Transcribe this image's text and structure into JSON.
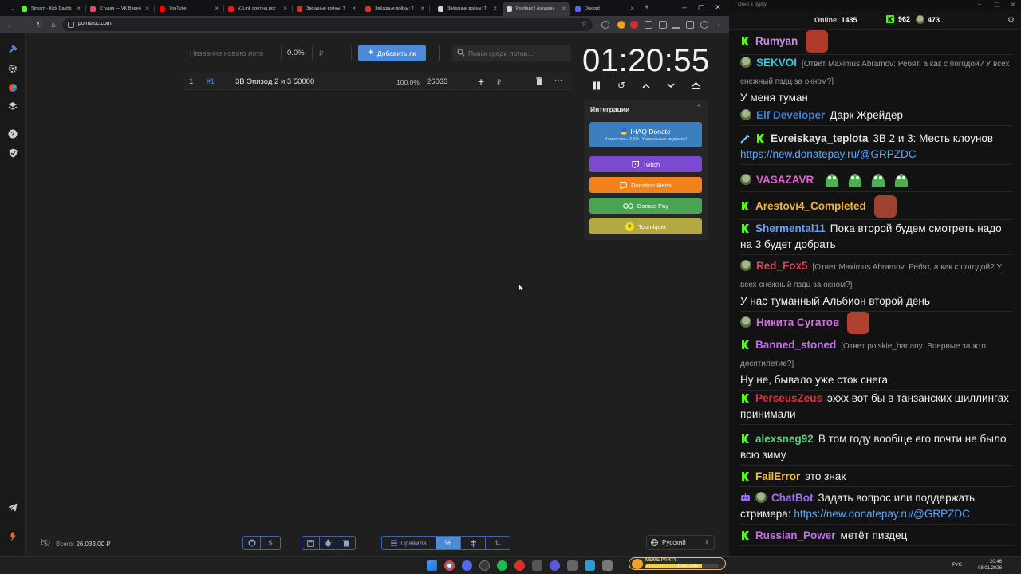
{
  "browser": {
    "tabs": [
      {
        "title": "Stream - Kick Dashb",
        "favicon_color": "#53fc18"
      },
      {
        "title": "Студия — VK Видео",
        "favicon_color": "#e64a6a"
      },
      {
        "title": "YouTube",
        "favicon_color": "#ff0000"
      },
      {
        "title": "VJLink орёт на пос",
        "favicon_color": "#e02020"
      },
      {
        "title": "Звёздные войны: Т",
        "favicon_color": "#c0392b"
      },
      {
        "title": "Звёздные войны: Т",
        "favicon_color": "#c0392b"
      },
      {
        "title": "Звёздные войны: Т",
        "favicon_color": "#d0d0d0"
      },
      {
        "title": "Pointauc | Аукцион",
        "favicon_color": "#d0d0d0"
      },
      {
        "title": "Discord",
        "favicon_color": "#5865f2"
      }
    ],
    "url": "pointauc.com"
  },
  "auction": {
    "lot_name_placeholder": "Название нового лота",
    "percent": "0.0%",
    "amount_placeholder": "₽",
    "add_button": "Добавить лк",
    "search_placeholder": "Поиск среди лотов...",
    "lot": {
      "index": "1",
      "id": "#1",
      "name": "3В Эпизод 2 и 3 50000",
      "percent": "100.0%",
      "amount": "26033",
      "currency": "₽"
    },
    "timer": "01:20:55",
    "total_label": "Всего:",
    "total_value": "26.033,00 ₽",
    "rules_label": "Правила",
    "language": "Русский"
  },
  "integrations": {
    "title": "Интеграции",
    "ihaq_label": "IHAQ Donate",
    "ihaq_sub": "Комиссия – 3,5%. Уникальные виджеты!",
    "twitch": "Twitch",
    "donation_alerts": "Donation Alerts",
    "donate_pay": "Donate Pay",
    "tourniquet": "Tourniquet"
  },
  "chat": {
    "window_title": "Окно в дурку",
    "online_label": "Online:",
    "online_count": "1435",
    "stat_kick": "962",
    "stat_other": "473",
    "messages": [
      {
        "user": "Rumyan",
        "color": "#c98ee8",
        "badges": [
          "kick"
        ],
        "emote": "#b03a2a"
      },
      {
        "user": "SEKVOI",
        "color": "#3ec8d8",
        "badges": [
          "frog"
        ],
        "reply": "[Ответ Maximus Abramov: Ребят, а как с погодой? У всех снежный пздц за окном?]",
        "text": "У меня туман"
      },
      {
        "user": "Elf Developer",
        "color": "#3d7fd4",
        "badges": [
          "frog"
        ],
        "text": "Дарк Жрейдер"
      },
      {
        "user": "Evreiskaya_teplota",
        "color": "#e0e0e0",
        "badges": [
          "sword",
          "kick"
        ],
        "text": "3В 2 и 3: Месть клоунов",
        "link": "https://new.donatepay.ru/@GRPZDC"
      },
      {
        "user": "VASAZAVR",
        "color": "#e060d0",
        "badges": [
          "frog"
        ],
        "emotes": 4
      },
      {
        "user": "Arestovi4_Completed",
        "color": "#f0b040",
        "badges": [
          "kick"
        ],
        "emote": "#a04030"
      },
      {
        "user": "Shermental11",
        "color": "#6aa0f0",
        "badges": [
          "kick"
        ],
        "text": "Пока второй будем смотреть,надо на 3 будет добрать"
      },
      {
        "user": "Red_Fox5",
        "color": "#e04050",
        "badges": [
          "frog"
        ],
        "reply": "[Ответ Maximus Abramov: Ребят, а как с погодой? У всех снежный пздц за окном?]",
        "text": "У нас туманный Альбион второй день"
      },
      {
        "user": "Никита Сугатов",
        "color": "#d070e0",
        "badges": [
          "frog"
        ],
        "emote": "#b04030"
      },
      {
        "user": "Banned_stoned",
        "color": "#c070e8",
        "badges": [
          "kick"
        ],
        "reply": "[Ответ polskie_banany: Впервые за жто десятилетие?]",
        "text": "Ну не, бывало уже сток снега"
      },
      {
        "user": "PerseusZeus",
        "color": "#e03040",
        "badges": [
          "kick"
        ],
        "text": "эхxx вот бы в танзанских шиллингах принимали"
      },
      {
        "user": "alexsneg92",
        "color": "#5fd080",
        "badges": [
          "kick"
        ],
        "text": "В том году вообще его почти не было всю зиму"
      },
      {
        "user": "FailError",
        "color": "#f0c040",
        "badges": [
          "kick"
        ],
        "text": "это знак"
      },
      {
        "user": "ChatBot",
        "color": "#a070f0",
        "badges": [
          "robot",
          "frog"
        ],
        "text": "Задать вопрос или поддержать стримера:",
        "link": "https://new.donatepay.ru/@GRPZDC"
      },
      {
        "user": "Russian_Power",
        "color": "#c070e8",
        "badges": [
          "kick"
        ],
        "text": "метёт пиздец"
      }
    ]
  },
  "taskbar": {
    "lang": "РУС",
    "time": "20:46",
    "date": "08.01.2026",
    "meme_title": "MEME PARTY",
    "meme_value": "1154 / 1500",
    "meme_progress": 0.77
  }
}
